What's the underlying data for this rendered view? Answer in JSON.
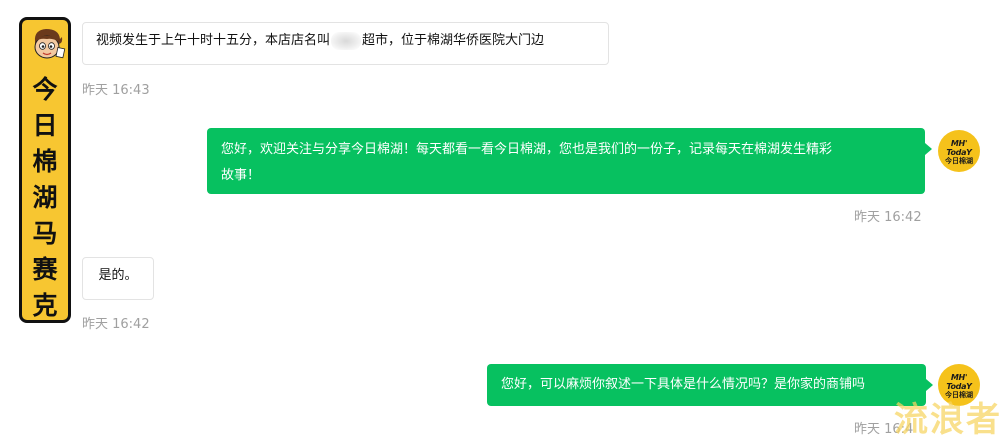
{
  "left_badge": {
    "title_chars": [
      "今",
      "日",
      "棉",
      "湖",
      "马",
      "赛",
      "克"
    ]
  },
  "messages": [
    {
      "id": "m1",
      "text_before": "视频发生于上午十时十五分，本店店名叫",
      "text_after": "超市，位于棉湖华侨医院大门边",
      "time": "昨天 16:43"
    },
    {
      "id": "m2",
      "line1": "您好，欢迎关注与分享今日棉湖！每天都看一看今日棉湖，您也是我们的一份子，记录每天在棉湖发生精彩",
      "line2": "故事！",
      "time": "昨天 16:42"
    },
    {
      "id": "m3",
      "text": "是的。",
      "time": "昨天 16:42"
    },
    {
      "id": "m4",
      "text": "您好，可以麻烦你叙述一下具体是什么情况吗？是你家的商铺吗",
      "time": "昨天 16:4"
    }
  ],
  "avatar_logo": {
    "line1": "MH' TodaY",
    "line2": "今日棉湖"
  },
  "watermark": "流浪者",
  "colors": {
    "outgoing_bubble": "#07c160",
    "badge_yellow": "#f7c631",
    "timestamp": "#a0a0a0"
  }
}
